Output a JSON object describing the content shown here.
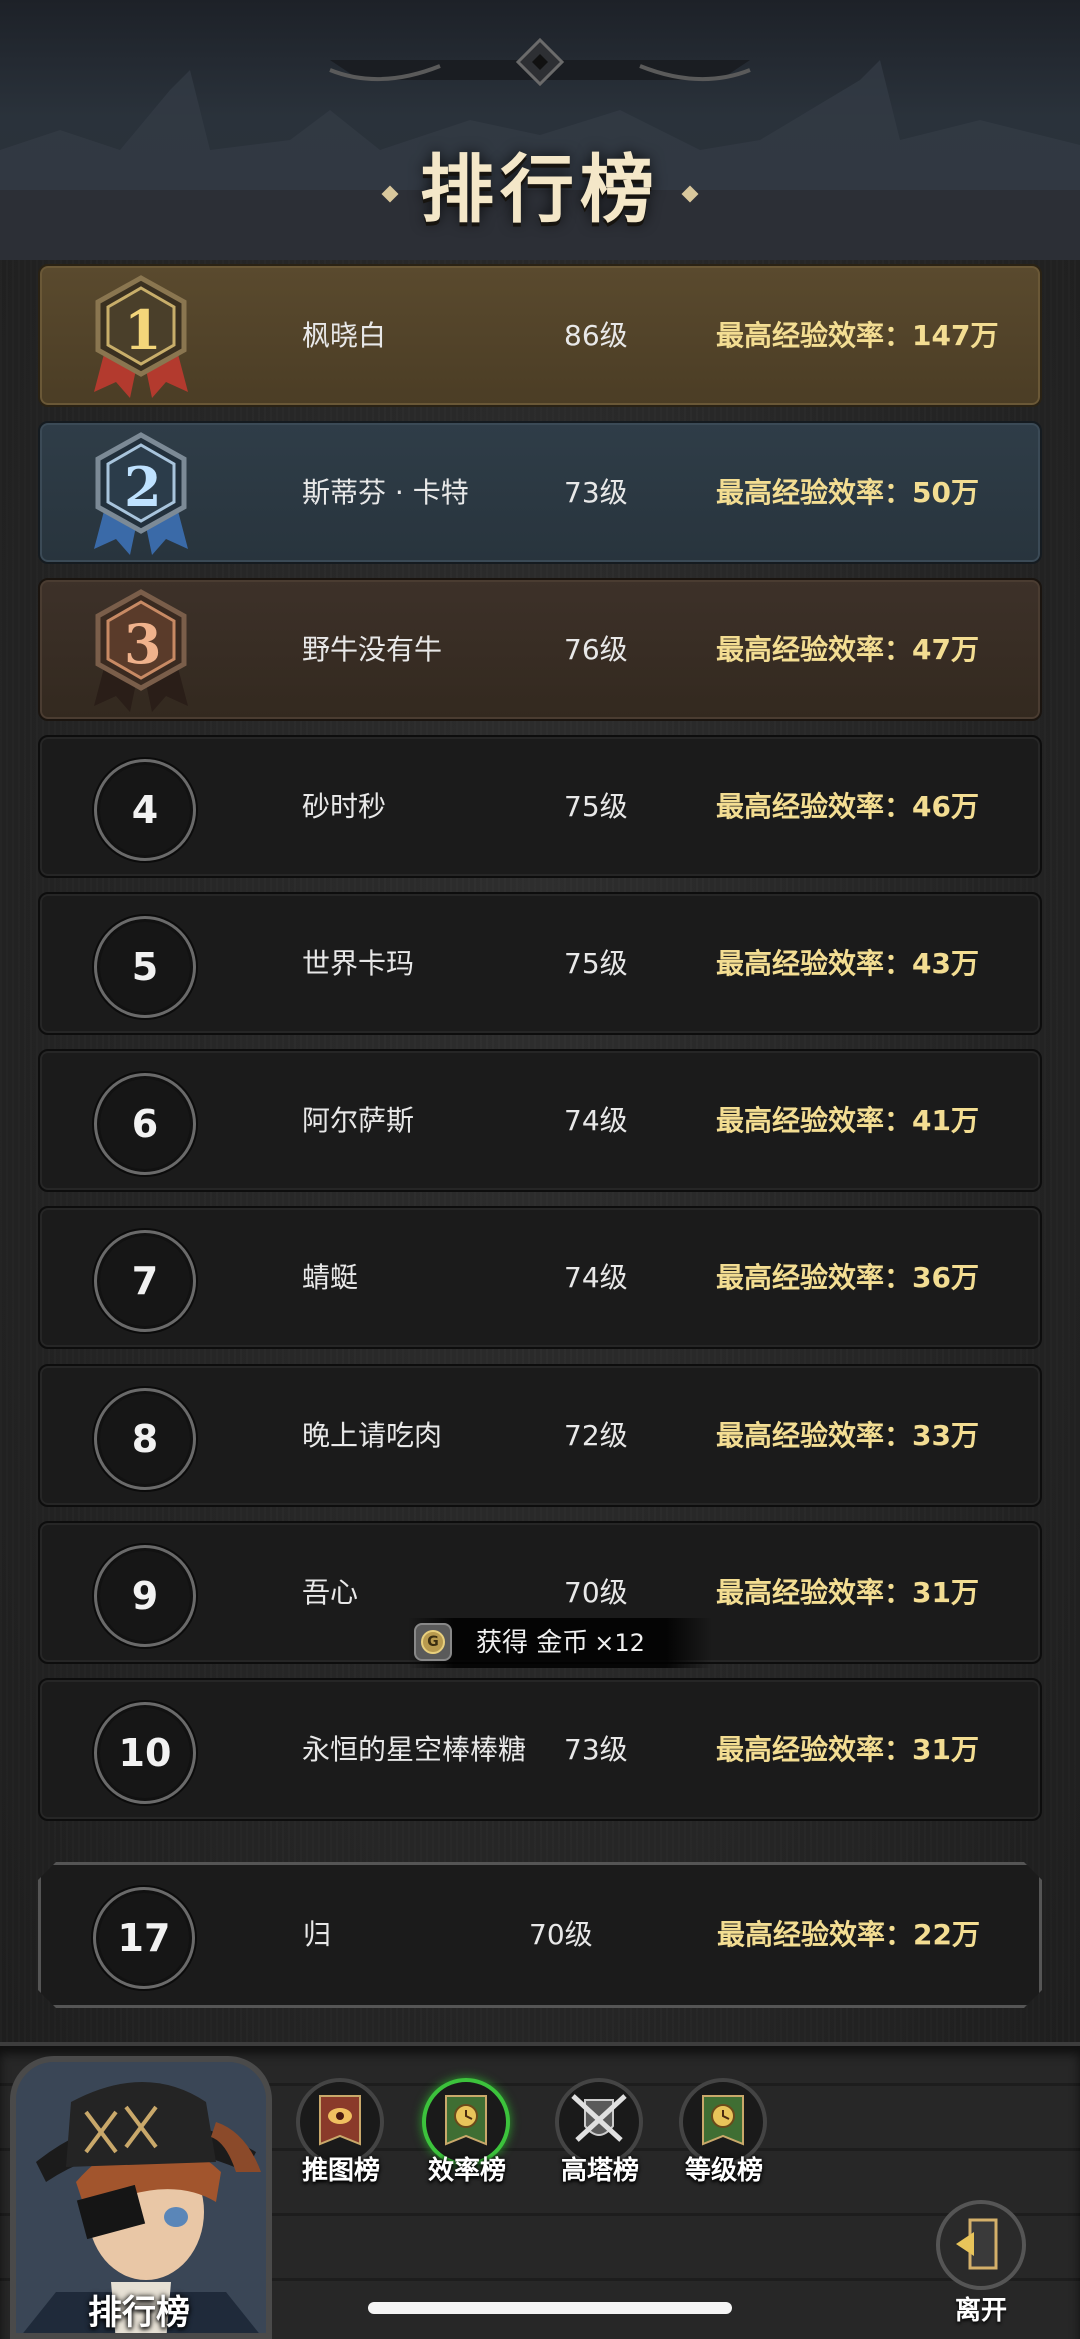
{
  "header": {
    "title": "排行榜"
  },
  "stat_prefix": "最高经验效率：",
  "rows": [
    {
      "rank": "1",
      "name": "枫晓白",
      "level": "86级",
      "stat": "最高经验效率：147万"
    },
    {
      "rank": "2",
      "name": "斯蒂芬 · 卡特",
      "level": "73级",
      "stat": "最高经验效率：50万"
    },
    {
      "rank": "3",
      "name": "野牛没有牛",
      "level": "76级",
      "stat": "最高经验效率：47万"
    },
    {
      "rank": "4",
      "name": "砂时秒",
      "level": "75级",
      "stat": "最高经验效率：46万"
    },
    {
      "rank": "5",
      "name": "世界卡玛",
      "level": "75级",
      "stat": "最高经验效率：43万"
    },
    {
      "rank": "6",
      "name": "阿尔萨斯",
      "level": "74级",
      "stat": "最高经验效率：41万"
    },
    {
      "rank": "7",
      "name": "蜻蜓",
      "level": "74级",
      "stat": "最高经验效率：36万"
    },
    {
      "rank": "8",
      "name": "晚上请吃肉",
      "level": "72级",
      "stat": "最高经验效率：33万"
    },
    {
      "rank": "9",
      "name": "吾心",
      "level": "70级",
      "stat": "最高经验效率：31万"
    },
    {
      "rank": "10",
      "name": "永恒的星空棒棒糖",
      "level": "73级",
      "stat": "最高经验效率：31万"
    }
  ],
  "my_row": {
    "rank": "17",
    "name": "归",
    "level": "70级",
    "stat": "最高经验效率：22万"
  },
  "toast": {
    "text": "获得 金币",
    "count": "×12",
    "icon": "gold-coin-icon",
    "coin_letter": "G"
  },
  "nav": {
    "current_label": "排行榜",
    "tabs": [
      {
        "label": "推图榜",
        "icon": "eye-banner-icon",
        "active": false
      },
      {
        "label": "效率榜",
        "icon": "clock-banner-icon",
        "active": true
      },
      {
        "label": "高塔榜",
        "icon": "crossed-swords-shield-icon",
        "active": false
      },
      {
        "label": "等级榜",
        "icon": "clock-banner-icon",
        "active": false
      }
    ],
    "leave_label": "离开"
  },
  "colors": {
    "stat_gold": "#f3dd92",
    "active_tab": "#3cc33c",
    "rank1": "#5a4a2e",
    "rank2": "#2f3d48",
    "rank3": "#3d3129"
  }
}
